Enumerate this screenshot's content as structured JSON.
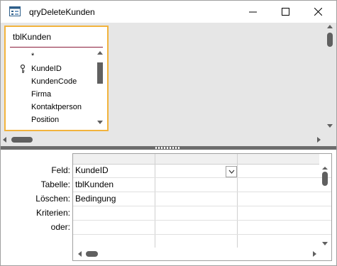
{
  "window": {
    "title": "qryDeleteKunden",
    "icon": "query-icon"
  },
  "table": {
    "name": "tblKunden",
    "fields": [
      {
        "label": "*",
        "key": false
      },
      {
        "label": "KundeID",
        "key": true
      },
      {
        "label": "KundenCode",
        "key": false
      },
      {
        "label": "Firma",
        "key": false
      },
      {
        "label": "Kontaktperson",
        "key": false
      },
      {
        "label": "Position",
        "key": false
      }
    ]
  },
  "grid": {
    "row_labels": [
      "Feld:",
      "Tabelle:",
      "Löschen:",
      "Kriterien:",
      "oder:"
    ],
    "column1": {
      "field": "KundeID",
      "table": "tblKunden",
      "delete": "Bedingung"
    }
  },
  "colors": {
    "focus_border": "#f2b33d",
    "pane_bg": "#e6e6e6",
    "splitter": "#6c6c6c"
  }
}
